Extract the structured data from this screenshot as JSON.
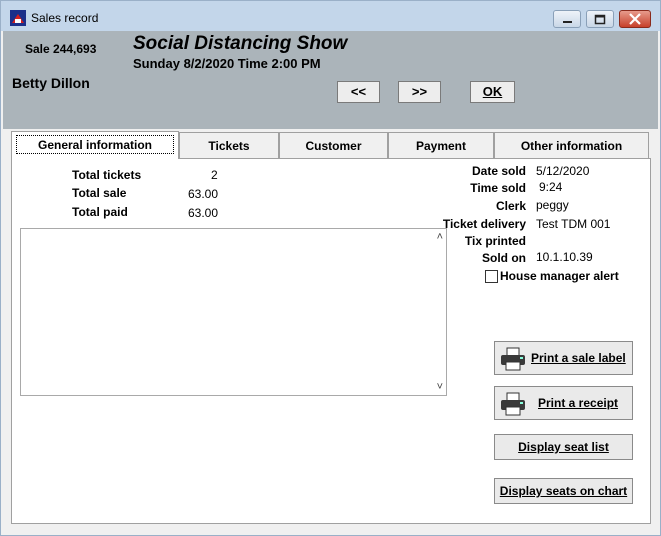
{
  "window": {
    "title": "Sales record",
    "controls": {
      "minimize": "minimize",
      "maximize": "maximize",
      "close": "close"
    }
  },
  "header": {
    "sale_number": "Sale 244,693",
    "show_title": "Social Distancing Show",
    "show_when": "Sunday 8/2/2020  Time 2:00 PM",
    "customer_name": "Betty Dillon",
    "prev_label": "<<",
    "next_label": ">>",
    "ok_label": "OK"
  },
  "tabs": [
    {
      "label": "General information",
      "active": true
    },
    {
      "label": "Tickets"
    },
    {
      "label": "Customer"
    },
    {
      "label": "Payment"
    },
    {
      "label": "Other information"
    }
  ],
  "totals": {
    "total_tickets_label": "Total tickets",
    "total_tickets_value": "2",
    "total_sale_label": "Total sale",
    "total_sale_value": "63.00",
    "total_paid_label": "Total paid",
    "total_paid_value": "63.00"
  },
  "details": {
    "date_sold_label": "Date sold",
    "date_sold_value": "5/12/2020",
    "time_sold_label": "Time sold",
    "time_sold_value": "9:24",
    "clerk_label": "Clerk",
    "clerk_value": "peggy",
    "ticket_delivery_label": "Ticket delivery",
    "ticket_delivery_value": "Test TDM 001",
    "tix_printed_label": "Tix printed",
    "tix_printed_value": "",
    "sold_on_label": "Sold on",
    "sold_on_value": "10.1.10.39",
    "house_manager_alert_label": "House manager alert",
    "house_manager_alert_checked": false
  },
  "actions": {
    "print_sale_label": "Print a sale label",
    "print_receipt": "Print a receipt",
    "display_seat_list": "Display seat list",
    "display_seats_on_chart": "Display seats on chart"
  },
  "colors": {
    "header_bg": "#abb4ba",
    "titlebar_bg": "#c3d6ea"
  }
}
